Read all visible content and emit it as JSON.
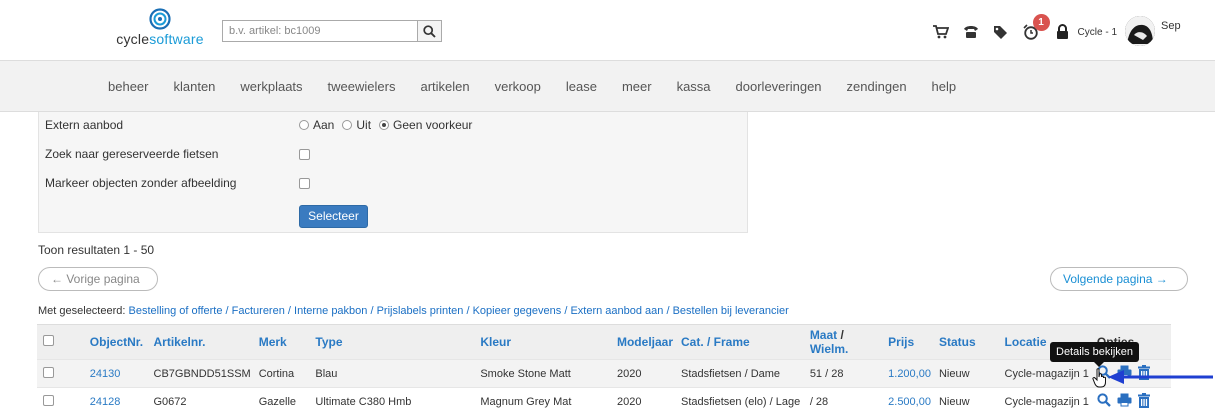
{
  "header": {
    "logo_text_a": "cycle",
    "logo_text_b": "software",
    "search_placeholder": "b.v. artikel: bc1009",
    "notification_count": "1",
    "cycle_label": "Cycle - 1",
    "user_name": "Sep",
    "icons": [
      "cart-icon",
      "phone-icon",
      "tag-icon",
      "alarm-clock-icon",
      "lock-icon"
    ]
  },
  "nav": {
    "items": [
      "beheer",
      "klanten",
      "werkplaats",
      "tweewielers",
      "artikelen",
      "verkoop",
      "lease",
      "meer",
      "kassa",
      "doorleveringen",
      "zendingen",
      "help"
    ]
  },
  "filters": {
    "extern_label": "Extern aanbod",
    "extern_options": [
      "Aan",
      "Uit",
      "Geen voorkeur"
    ],
    "extern_selected": "Geen voorkeur",
    "reserved_label": "Zoek naar gereserveerde fietsen",
    "no_image_label": "Markeer objecten zonder afbeelding",
    "submit_label": "Selecteer"
  },
  "results": {
    "count_text": "Toon resultaten 1 - 50",
    "prev_label": "← Vorige pagina",
    "next_label": "Volgende pagina →"
  },
  "bulk": {
    "prefix": "Met geselecteerd:",
    "actions": [
      "Bestelling of offerte",
      "Factureren",
      "Interne pakbon",
      "Prijslabels printen",
      "Kopieer gegevens",
      "Extern aanbod aan",
      "Bestellen bij leverancier"
    ]
  },
  "table": {
    "headers": {
      "objectnr": "ObjectNr.",
      "artikelnr": "Artikelnr.",
      "merk": "Merk",
      "type": "Type",
      "kleur": "Kleur",
      "modeljaar": "Modeljaar",
      "cat": "Cat. / Frame",
      "maat": "Maat",
      "slash": " / ",
      "wielm": "Wielm.",
      "prijs": "Prijs",
      "status": "Status",
      "locatie": "Locatie",
      "opties": "Opties"
    },
    "rows": [
      {
        "objectnr": "24130",
        "artikelnr": "CB7GBNDD51SSM",
        "merk": "Cortina",
        "type": "Blau",
        "kleur": "Smoke Stone Matt",
        "modeljaar": "2020",
        "cat": "Stadsfietsen / Dame",
        "maat": "51 / 28",
        "prijs": "1.200,00",
        "status": "Nieuw",
        "locatie": "Cycle-magazijn 1"
      },
      {
        "objectnr": "24128",
        "artikelnr": "G0672",
        "merk": "Gazelle",
        "type": "Ultimate C380 Hmb",
        "kleur": "Magnum Grey Mat",
        "modeljaar": "2020",
        "cat": "Stadsfietsen (elo) / Lage",
        "maat": "/ 28",
        "prijs": "2.500,00",
        "status": "Nieuw",
        "locatie": "Cycle-magazijn 1"
      }
    ],
    "tooltip": "Details bekijken"
  },
  "colors": {
    "accent": "#2a7ac4",
    "primary_button": "#3a7bc0",
    "badge": "#d9534f",
    "annotation_arrow": "#1f3fd1"
  }
}
